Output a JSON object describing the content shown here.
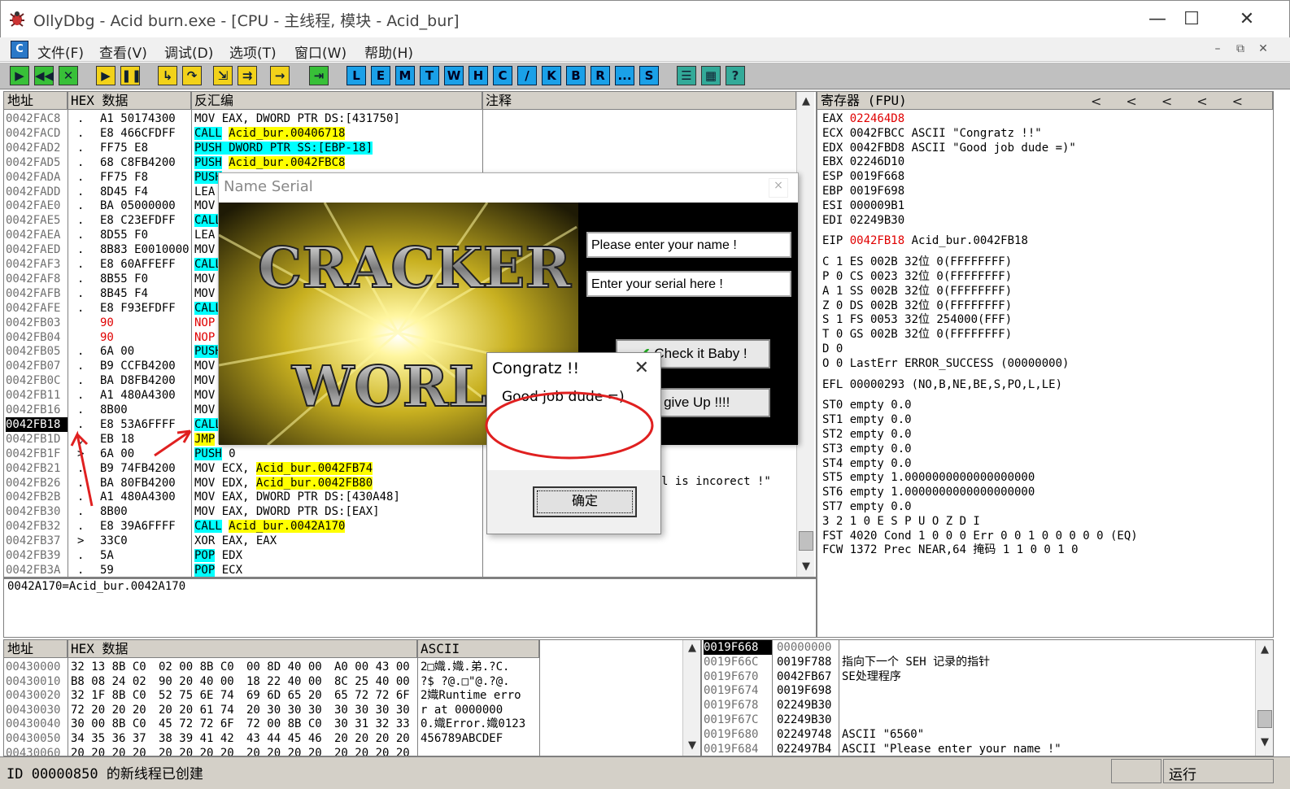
{
  "window": {
    "title": "OllyDbg - Acid burn.exe - [CPU - 主线程, 模块 - Acid_bur]",
    "minimize": "—",
    "maximize": "☐",
    "close": "✕"
  },
  "menu": {
    "items": [
      "文件(F)",
      "查看(V)",
      "调试(D)",
      "选项(T)",
      "窗口(W)",
      "帮助(H)"
    ]
  },
  "toolbar": {
    "letters": [
      "L",
      "E",
      "M",
      "T",
      "W",
      "H",
      "C",
      "/",
      "K",
      "B",
      "R",
      "...",
      "S"
    ]
  },
  "disasm": {
    "headers": {
      "addr": "地址",
      "hex": "HEX 数据",
      "asm": "反汇编",
      "comment": "注释"
    },
    "rows": [
      {
        "a": "0042FAC8",
        "m": ".",
        "h": "A1 50174300",
        "t": "MOV EAX, DWORD PTR DS:[431750]"
      },
      {
        "a": "0042FACD",
        "m": ".",
        "h": "E8 466CFDFF",
        "t": "CALL Acid_bur.00406718"
      },
      {
        "a": "0042FAD2",
        "m": ".",
        "h": "FF75 E8",
        "t": "PUSH DWORD PTR SS:[EBP-18]"
      },
      {
        "a": "0042FAD5",
        "m": ".",
        "h": "68 C8FB4200",
        "t": "PUSH Acid_bur.0042FBC8"
      },
      {
        "a": "0042FADA",
        "m": ".",
        "h": "FF75 F8",
        "t": "PUSH"
      },
      {
        "a": "0042FADD",
        "m": ".",
        "h": "8D45 F4",
        "t": "LEA"
      },
      {
        "a": "0042FAE0",
        "m": ".",
        "h": "BA 05000000",
        "t": "MOV"
      },
      {
        "a": "0042FAE5",
        "m": ".",
        "h": "E8 C23EFDFF",
        "t": "CALL"
      },
      {
        "a": "0042FAEA",
        "m": ".",
        "h": "8D55 F0",
        "t": "LEA"
      },
      {
        "a": "0042FAED",
        "m": ".",
        "h": "8B83 E0010000",
        "t": "MOV"
      },
      {
        "a": "0042FAF3",
        "m": ".",
        "h": "E8 60AFFEFF",
        "t": "CALL"
      },
      {
        "a": "0042FAF8",
        "m": ".",
        "h": "8B55 F0",
        "t": "MOV"
      },
      {
        "a": "0042FAFB",
        "m": ".",
        "h": "8B45 F4",
        "t": "MOV"
      },
      {
        "a": "0042FAFE",
        "m": ".",
        "h": "E8 F93EFDFF",
        "t": "CALL"
      },
      {
        "a": "0042FB03",
        "m": "",
        "h": "90",
        "t": "NOP"
      },
      {
        "a": "0042FB04",
        "m": "",
        "h": "90",
        "t": "NOP"
      },
      {
        "a": "0042FB05",
        "m": ".",
        "h": "6A 00",
        "t": "PUSH"
      },
      {
        "a": "0042FB07",
        "m": ".",
        "h": "B9 CCFB4200",
        "t": "MOV"
      },
      {
        "a": "0042FB0C",
        "m": ".",
        "h": "BA D8FB4200",
        "t": "MOV"
      },
      {
        "a": "0042FB11",
        "m": ".",
        "h": "A1 480A4300",
        "t": "MOV"
      },
      {
        "a": "0042FB16",
        "m": ".",
        "h": "8B00",
        "t": "MOV"
      },
      {
        "a": "0042FB18",
        "m": ".",
        "h": "E8 53A6FFFF",
        "t": "CALL"
      },
      {
        "a": "0042FB1D",
        "m": "⌄",
        "h": "EB 18",
        "t": "JMP"
      },
      {
        "a": "0042FB1F",
        "m": ">",
        "h": "6A 00",
        "t": "PUSH 0"
      },
      {
        "a": "0042FB21",
        "m": ".",
        "h": "B9 74FB4200",
        "t": "MOV ECX, Acid_bur.0042FB74"
      },
      {
        "a": "0042FB26",
        "m": ".",
        "h": "BA 80FB4200",
        "t": "MOV EDX, Acid_bur.0042FB80"
      },
      {
        "a": "0042FB2B",
        "m": ".",
        "h": "A1 480A4300",
        "t": "MOV EAX, DWORD PTR DS:[430A48]"
      },
      {
        "a": "0042FB30",
        "m": ".",
        "h": "8B00",
        "t": "MOV EAX, DWORD PTR DS:[EAX]"
      },
      {
        "a": "0042FB32",
        "m": ".",
        "h": "E8 39A6FFFF",
        "t": "CALL Acid_bur.0042A170"
      },
      {
        "a": "0042FB37",
        "m": ">",
        "h": "33C0",
        "t": "XOR EAX, EAX"
      },
      {
        "a": "0042FB39",
        "m": ".",
        "h": "5A",
        "t": "POP EDX"
      },
      {
        "a": "0042FB3A",
        "m": ".",
        "h": "59",
        "t": "POP ECX"
      }
    ],
    "comment_fragment": "l is incorect !\"",
    "info_line": "0042A170=Acid_bur.0042A170"
  },
  "registers": {
    "header": "寄存器 (FPU)",
    "lines": [
      "EAX 022464D8",
      "ECX 0042FBCC ASCII \"Congratz !!\"",
      "EDX 0042FBD8 ASCII \"Good job dude =)\"",
      "EBX 02246D10",
      "ESP 0019F668",
      "EBP 0019F698",
      "ESI 000009B1",
      "EDI 02249B30",
      "",
      "EIP 0042FB18 Acid_bur.0042FB18",
      "",
      "C 1  ES 002B 32位 0(FFFFFFFF)",
      "P 0  CS 0023 32位 0(FFFFFFFF)",
      "A 1  SS 002B 32位 0(FFFFFFFF)",
      "Z 0  DS 002B 32位 0(FFFFFFFF)",
      "S 1  FS 0053 32位 254000(FFF)",
      "T 0  GS 002B 32位 0(FFFFFFFF)",
      "D 0",
      "O 0  LastErr ERROR_SUCCESS (00000000)",
      "",
      "EFL 00000293 (NO,B,NE,BE,S,PO,L,LE)",
      "",
      "ST0 empty 0.0",
      "ST1 empty 0.0",
      "ST2 empty 0.0",
      "ST3 empty 0.0",
      "ST4 empty 0.0",
      "ST5 empty 1.0000000000000000000",
      "ST6 empty 1.0000000000000000000",
      "ST7 empty 0.0",
      "           3 2 1 0      E S P U O Z D I",
      "FST 4020  Cond 1 0 0 0  Err 0 0 1 0 0 0 0 0  (EQ)",
      "FCW 1372  Prec NEAR,64  掩码    1 1 0 0 1 0"
    ]
  },
  "dump": {
    "headers": {
      "addr": "地址",
      "hex": "HEX 数据",
      "ascii": "ASCII"
    },
    "rows": [
      {
        "a": "00430000",
        "h1": "32 13 8B C0",
        "h2": "02 00 8B C0",
        "h3": "00 8D 40 00",
        "h4": "A0 00 43 00",
        "s": "2□嬂.嬂.弟.?C."
      },
      {
        "a": "00430010",
        "h1": "B8 08 24 02",
        "h2": "90 20 40 00",
        "h3": "18 22 40 00",
        "h4": "8C 25 40 00",
        "s": "?$ ?@.□\"@.?@."
      },
      {
        "a": "00430020",
        "h1": "32 1F 8B C0",
        "h2": "52 75 6E 74",
        "h3": "69 6D 65 20",
        "h4": "65 72 72 6F",
        "s": "2嬂Runtime erro"
      },
      {
        "a": "00430030",
        "h1": "72 20 20 20",
        "h2": "20 20 61 74",
        "h3": "20 30 30 30",
        "h4": "30 30 30 30",
        "s": "r     at 0000000"
      },
      {
        "a": "00430040",
        "h1": "30 00 8B C0",
        "h2": "45 72 72 6F",
        "h3": "72 00 8B C0",
        "h4": "30 31 32 33",
        "s": "0.嬂Error.嬂0123"
      },
      {
        "a": "00430050",
        "h1": "34 35 36 37",
        "h2": "38 39 41 42",
        "h3": "43 44 45 46",
        "h4": "20 20 20 20",
        "s": "456789ABCDEF"
      },
      {
        "a": "00430060",
        "h1": "20 20 20 20",
        "h2": "20 20 20 20",
        "h3": "20 20 20 20",
        "h4": "20 20 20 20",
        "s": ""
      }
    ]
  },
  "stack": {
    "rows": [
      {
        "a": "0019F668",
        "v": "00000000",
        "c": ""
      },
      {
        "a": "0019F66C",
        "v": "0019F788",
        "c": "指向下一个 SEH 记录的指针"
      },
      {
        "a": "0019F670",
        "v": "0042FB67",
        "c": "SE处理程序"
      },
      {
        "a": "0019F674",
        "v": "0019F698",
        "c": ""
      },
      {
        "a": "0019F678",
        "v": "02249B30",
        "c": ""
      },
      {
        "a": "0019F67C",
        "v": "02249B30",
        "c": ""
      },
      {
        "a": "0019F680",
        "v": "02249748",
        "c": "ASCII \"6560\""
      },
      {
        "a": "0019F684",
        "v": "022497B4",
        "c": "ASCII \"Please enter your name !\""
      }
    ]
  },
  "status": {
    "message": "ID 00000850 的新线程已创建",
    "state": "运行"
  },
  "name_serial": {
    "title": "Name Serial",
    "close": "×",
    "banner_line1": "CRACKER",
    "banner_line2": "WORLD",
    "name_field": "Please enter your name !",
    "serial_field": "Enter your serial here !",
    "check_btn": "Check it Baby !",
    "giveup_btn": "I give Up !!!!"
  },
  "congrats": {
    "title": "Congratz !!",
    "close": "✕",
    "message": "Good job dude =)",
    "ok": "确定"
  }
}
